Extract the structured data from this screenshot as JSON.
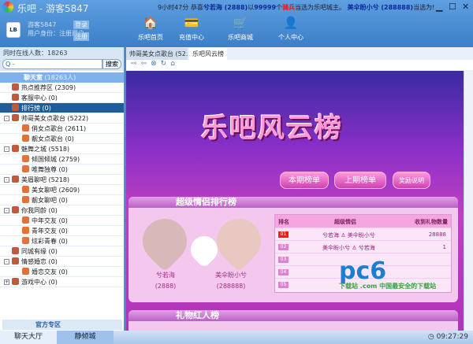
{
  "window": {
    "title": "乐吧 - 游客5847",
    "marquee": {
      "time": "9小时47分",
      "t1": "恭喜",
      "n1": "兮若海 (2888)",
      "t2": "以",
      "amount": "99999",
      "t3": "个",
      "gift": "骑兵",
      "t4": "当选为乐吧城主。",
      "n2": "美伞盼小兮 (288888)",
      "t5": "当选为!"
    }
  },
  "user": {
    "name": "游客5847",
    "role": "用户身份：注册用户",
    "login": "登录",
    "register": "注册",
    "logo": "LB"
  },
  "nav": [
    {
      "label": "乐吧首页",
      "icon": "home-icon"
    },
    {
      "label": "充值中心",
      "icon": "card-icon"
    },
    {
      "label": "乐吧商城",
      "icon": "cart-icon"
    },
    {
      "label": "个人中心",
      "icon": "person-icon"
    }
  ],
  "sidebar": {
    "online": "同时在线人数：18263",
    "search_btn": "搜索",
    "search_icon": "Q -",
    "root": "聊天室",
    "root_count": "(18263人)",
    "items": [
      {
        "label": "热点推荐区 (2309)",
        "level": 0
      },
      {
        "label": "客服中心 (0)",
        "level": 0
      },
      {
        "label": "排行榜 (0)",
        "level": 0,
        "selected": true
      },
      {
        "label": "帅哥美女点歌台 (5222)",
        "level": 0,
        "toggle": "-"
      },
      {
        "label": "俏女点歌台 (2611)",
        "level": 1
      },
      {
        "label": "靓女点歌台 (0)",
        "level": 1
      },
      {
        "label": "魅舞之城 (5518)",
        "level": 0,
        "toggle": "-"
      },
      {
        "label": "倾国倾城 (2759)",
        "level": 1
      },
      {
        "label": "唯舞独尊 (0)",
        "level": 1
      },
      {
        "label": "美眉聊吧 (5218)",
        "level": 0,
        "toggle": "-"
      },
      {
        "label": "美女聊吧 (2609)",
        "level": 1
      },
      {
        "label": "靓女聊吧 (0)",
        "level": 1
      },
      {
        "label": "你我同龄 (0)",
        "level": 0,
        "toggle": "-"
      },
      {
        "label": "中年交友 (0)",
        "level": 1
      },
      {
        "label": "青年交友 (0)",
        "level": 1
      },
      {
        "label": "炫彩青春 (0)",
        "level": 1
      },
      {
        "label": "同城有缘 (0)",
        "level": 0
      },
      {
        "label": "情感婚恋 (0)",
        "level": 0,
        "toggle": "-"
      },
      {
        "label": "婚恋交友 (0)",
        "level": 1
      },
      {
        "label": "游戏中心 (0)",
        "level": 0,
        "toggle": "+"
      }
    ],
    "official": "官方专区"
  },
  "tabs": [
    "帅哥美女点歌台 (52...",
    "乐吧风云榜"
  ],
  "toolbar": [
    "⇨",
    "⇦",
    "⊗",
    "↻",
    "⌂"
  ],
  "content": {
    "banner": "乐吧风云榜",
    "buttons": [
      "本期榜单",
      "上期榜单",
      "奖励说明"
    ],
    "section1": "超级情侣排行榜",
    "male": "兮若海",
    "male_id": "(2888)",
    "female": "美伞盼小兮",
    "female_id": "(288888)",
    "headers": [
      "排名",
      "超级情侣",
      "收到礼物数量"
    ],
    "rows": [
      {
        "rank": "01",
        "pair": "兮若海 ♙ 美伞盼小兮",
        "count": "28888"
      },
      {
        "rank": "02",
        "pair": "美伞盼小兮 ♙ 兮若海",
        "count": "1"
      },
      {
        "rank": "03",
        "pair": "",
        "count": ""
      },
      {
        "rank": "04",
        "pair": "",
        "count": ""
      },
      {
        "rank": "05",
        "pair": "",
        "count": ""
      }
    ],
    "section2": "礼物红人榜",
    "watermark": "pc6",
    "watermark_sub": "下载站 .com 中国最安全的下载站"
  },
  "bottom": {
    "tabs": [
      "聊天大厅",
      "静倾城"
    ],
    "clock": "09:27:29"
  }
}
